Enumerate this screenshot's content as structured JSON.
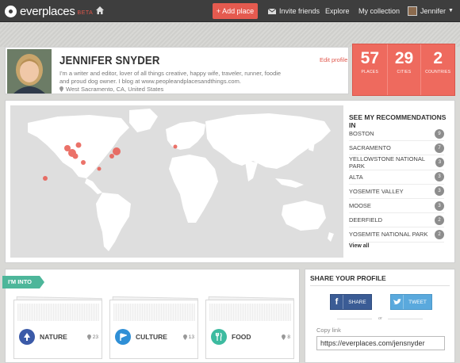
{
  "nav": {
    "logo_text": "everplaces",
    "logo_badge": "BETA",
    "add_place": "+ Add place",
    "invite": "Invite friends",
    "explore": "Explore",
    "collection": "My collection",
    "user": "Jennifer"
  },
  "profile": {
    "name": "JENNIFER SNYDER",
    "bio": "I'm a writer and editor, lover of all things creative, happy wife, traveler, runner, foodie and proud dog owner. I blog at www.peopleandplacesandthings.com.",
    "location": "West Sacramento, CA, United States",
    "edit_label": "Edit profile"
  },
  "stats": [
    {
      "value": "57",
      "label": "PLACES"
    },
    {
      "value": "29",
      "label": "CITIES"
    },
    {
      "value": "2",
      "label": "COUNTRIES"
    }
  ],
  "recommendations": {
    "title": "SEE MY RECOMMENDATIONS IN",
    "items": [
      {
        "name": "BOSTON",
        "count": "9"
      },
      {
        "name": "SACRAMENTO",
        "count": "7"
      },
      {
        "name": "YELLOWSTONE NATIONAL PARK",
        "count": "3"
      },
      {
        "name": "ALTA",
        "count": "3"
      },
      {
        "name": "YOSEMITE VALLEY",
        "count": "3"
      },
      {
        "name": "MOOSE",
        "count": "3"
      },
      {
        "name": "DEERFIELD",
        "count": "2"
      },
      {
        "name": "YOSEMITE NATIONAL PARK",
        "count": "2"
      }
    ],
    "view_all": "View all"
  },
  "interests": {
    "tag": "I'M INTO",
    "items": [
      {
        "label": "NATURE",
        "count": "23",
        "color": "#3b5aa8",
        "icon": "tree-icon"
      },
      {
        "label": "CULTURE",
        "count": "13",
        "color": "#2f8fd6",
        "icon": "flag-icon"
      },
      {
        "label": "FOOD",
        "count": "8",
        "color": "#3dbba0",
        "icon": "utensils-icon"
      }
    ]
  },
  "share": {
    "title": "SHARE YOUR PROFILE",
    "facebook": "SHARE",
    "twitter": "TWEET",
    "or": "or",
    "copy_label": "Copy link",
    "link": "https://everplaces.com/jensnyder"
  },
  "colors": {
    "accent": "#e55a4f",
    "stats_bg": "#ee6a5e",
    "tag": "#4db69a"
  }
}
